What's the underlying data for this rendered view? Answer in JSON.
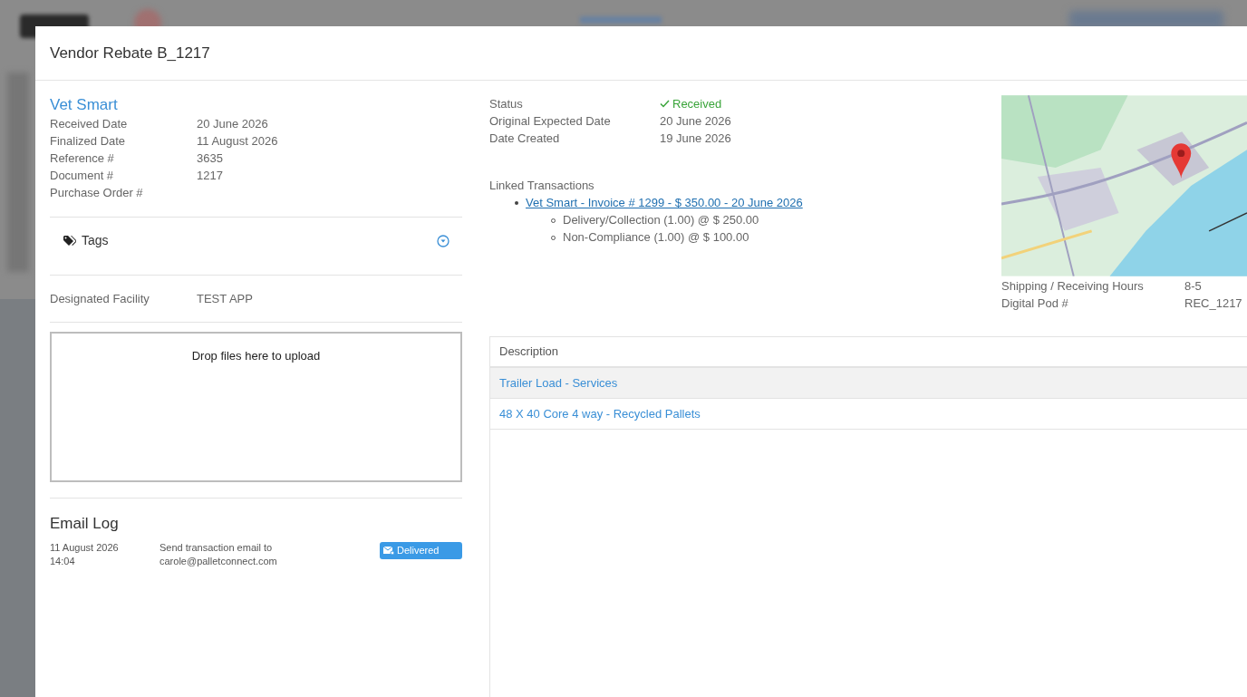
{
  "modal": {
    "title": "Vendor Rebate B_1217"
  },
  "vendor": {
    "name": "Vet Smart"
  },
  "details": [
    {
      "label": "Received Date",
      "value": "20 June 2026"
    },
    {
      "label": "Finalized Date",
      "value": "11 August 2026"
    },
    {
      "label": "Reference #",
      "value": "3635"
    },
    {
      "label": "Document #",
      "value": "1217"
    },
    {
      "label": "Purchase Order #"
    }
  ],
  "tags": {
    "label": "Tags",
    "expanded": false
  },
  "facility": {
    "label": "Designated Facility",
    "value": "TEST APP"
  },
  "dropzone": {
    "text": "Drop files here to upload"
  },
  "email_log": {
    "title": "Email Log",
    "entries": [
      {
        "date": "11 August 2026",
        "time": "14:04",
        "message": "Send transaction email to",
        "recipient": "carole@palletconnect.com",
        "status": "Delivered"
      }
    ]
  },
  "status_fields": [
    {
      "label": "Status",
      "value": "Received",
      "kind": "status"
    },
    {
      "label": "Original Expected Date",
      "value": "20 June 2026",
      "kind": "text"
    },
    {
      "label": "Date Created",
      "value": "19 June 2026",
      "kind": "text"
    }
  ],
  "linked": {
    "title": "Linked Transactions",
    "items": [
      {
        "text": "Vet Smart - Invoice # 1299 - $ 350.00 - 20 June 2026",
        "children": [
          {
            "text": "Delivery/Collection (1.00) @ $ 250.00"
          },
          {
            "text": "Non-Compliance (1.00) @ $ 100.00"
          }
        ]
      }
    ]
  },
  "location_fields": [
    {
      "label": "Shipping / Receiving Hours",
      "value": "8-5"
    },
    {
      "label": "Digital Pod #",
      "value": "REC_1217"
    }
  ],
  "table": {
    "columns": [
      "Description"
    ],
    "rows": [
      {
        "description": "Trailer Load - Services",
        "selected": true
      },
      {
        "description": "48 X 40 Core 4 way - Recycled Pallets",
        "selected": false
      }
    ]
  }
}
